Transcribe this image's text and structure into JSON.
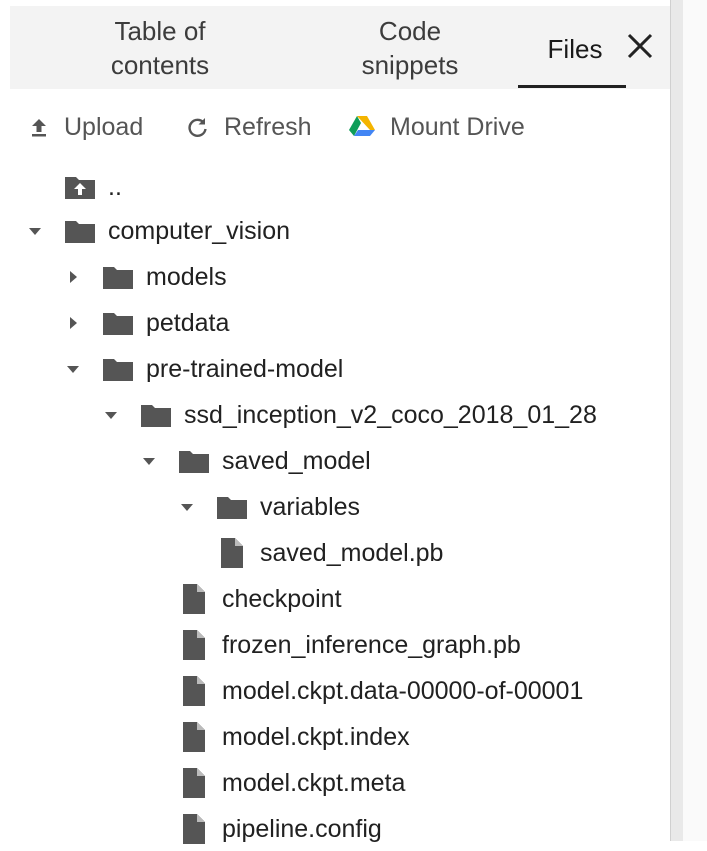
{
  "tabs": {
    "toc": "Table of\ncontents",
    "snippets": "Code\nsnippets",
    "files": "Files"
  },
  "toolbar": {
    "upload": "Upload",
    "refresh": "Refresh",
    "mount_drive": "Mount Drive"
  },
  "tree": {
    "parent": "..",
    "computer_vision": "computer_vision",
    "models": "models",
    "petdata": "petdata",
    "pretrained": "pre-trained-model",
    "ssd": "ssd_inception_v2_coco_2018_01_28",
    "saved_model": "saved_model",
    "variables": "variables",
    "saved_model_pb": "saved_model.pb",
    "checkpoint": "checkpoint",
    "frozen": "frozen_inference_graph.pb",
    "ckpt_data": "model.ckpt.data-00000-of-00001",
    "ckpt_index": "model.ckpt.index",
    "ckpt_meta": "model.ckpt.meta",
    "pipeline": "pipeline.config"
  },
  "colors": {
    "folder": "#555555",
    "text": "#212121",
    "drive_green": "#0f9d58",
    "drive_yellow": "#f4b400",
    "drive_blue": "#4285f4"
  }
}
